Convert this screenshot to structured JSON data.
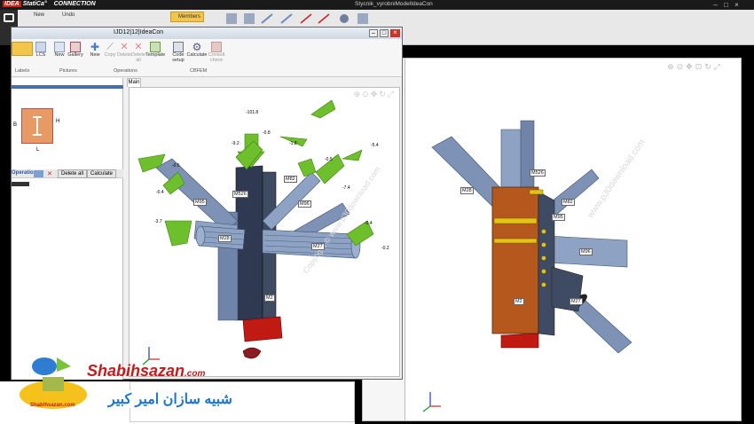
{
  "app": {
    "logo_text": "IDEA StatiCa",
    "logo_mark": "IDEA",
    "product": "CONNECTION",
    "window_title": "Stycnik_vyrobniModelIdeaCon",
    "ribbon": {
      "new": "New",
      "undo": "Undo",
      "members": "Members"
    }
  },
  "sub_window": {
    "title": "IJD12|12|IdeaCon",
    "groups": {
      "labels": "Labels",
      "pictures": "Pictures",
      "operations": "Operations",
      "cbfem": "CBFEM"
    },
    "buttons": {
      "lcs": "LCS",
      "new_pic": "New",
      "gallery": "Gallery",
      "new_op": "New",
      "copy": "Copy",
      "delete": "Delete",
      "delete_all": "Delete all",
      "template": "Template",
      "code_setup": "Code setup",
      "calculate": "Calculate",
      "consult": "Consult check"
    },
    "tab_main": "Main",
    "left_panel": {
      "ops_title": "Operations",
      "delete_all": "Delete all",
      "calculate": "Calculate",
      "dim_b": "B",
      "dim_h": "H",
      "dim_l": "L"
    }
  },
  "members_left": [
    "M2",
    "M28",
    "M27",
    "M95",
    "M526",
    "M96",
    "M82"
  ],
  "members_right": [
    "M526",
    "M28",
    "M82",
    "M96",
    "M95",
    "M2",
    "M27"
  ],
  "load_values": [
    "-101.8",
    "-9.2",
    "-0.5",
    "-3.7",
    "-0.4",
    "-5.4",
    "-0.5",
    "-7.4",
    "-0.4",
    "-1.8",
    "-0.2",
    "-0.8"
  ],
  "watermark": {
    "brand": "Shabihsazan",
    "brand_sub": ".com",
    "brand_fa": "شبیه سازان امیر کبیر",
    "site": "Copyright © www.p30download.com"
  },
  "colors": {
    "accent_green": "#6dbf2c",
    "steel_blue": "#7d92b5",
    "plate_red": "#c11a12",
    "plate_orange": "#b5581e",
    "bolt_yellow": "#e3c314"
  }
}
